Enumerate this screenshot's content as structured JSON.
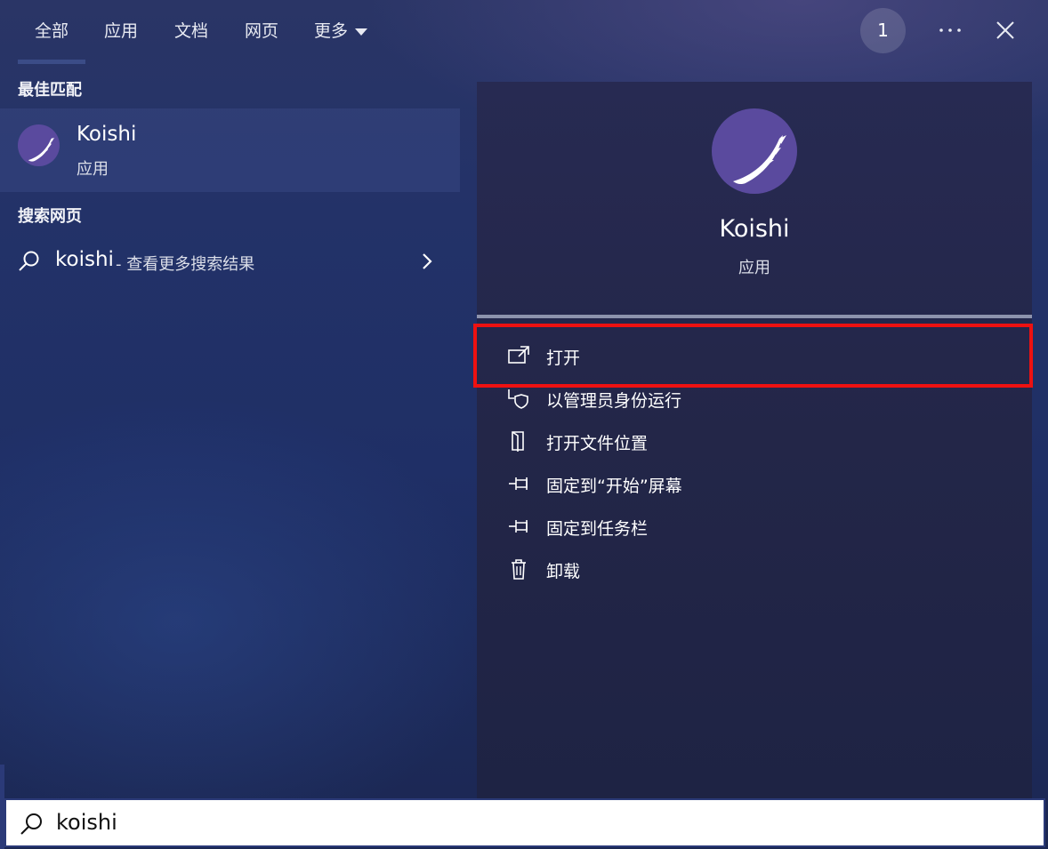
{
  "tabs": [
    {
      "label": "全部",
      "selected": true
    },
    {
      "label": "应用"
    },
    {
      "label": "文档"
    },
    {
      "label": "网页"
    },
    {
      "label": "更多",
      "icon": "caret-down-icon"
    }
  ],
  "header": {
    "badge_count": "1",
    "more_icon": "ellipsis-icon",
    "close_icon": "close-icon"
  },
  "results": {
    "best_match_title": "最佳匹配",
    "best_match": {
      "name": "Koishi",
      "type": "应用",
      "icon": "koishi-app-icon"
    },
    "web_title": "搜索网页",
    "web_item": {
      "query": "koishi",
      "hint": "- 查看更多搜索结果",
      "icon": "search-icon",
      "chevron": "chevron-right-icon"
    }
  },
  "preview": {
    "name": "Koishi",
    "type": "应用",
    "actions": [
      {
        "label": "打开",
        "icon": "open-icon",
        "highlighted": true
      },
      {
        "label": "以管理员身份运行",
        "icon": "shield-icon"
      },
      {
        "label": "打开文件位置",
        "icon": "file-location-icon"
      },
      {
        "label": "固定到“开始”屏幕",
        "icon": "pin-icon"
      },
      {
        "label": "固定到任务栏",
        "icon": "pin-icon"
      },
      {
        "label": "卸载",
        "icon": "trash-icon"
      }
    ]
  },
  "search": {
    "value": "koishi",
    "icon": "search-icon"
  },
  "colors": {
    "accent": "#5a4a9e",
    "highlight": "#ee1111",
    "background": "#1f2d5e"
  }
}
